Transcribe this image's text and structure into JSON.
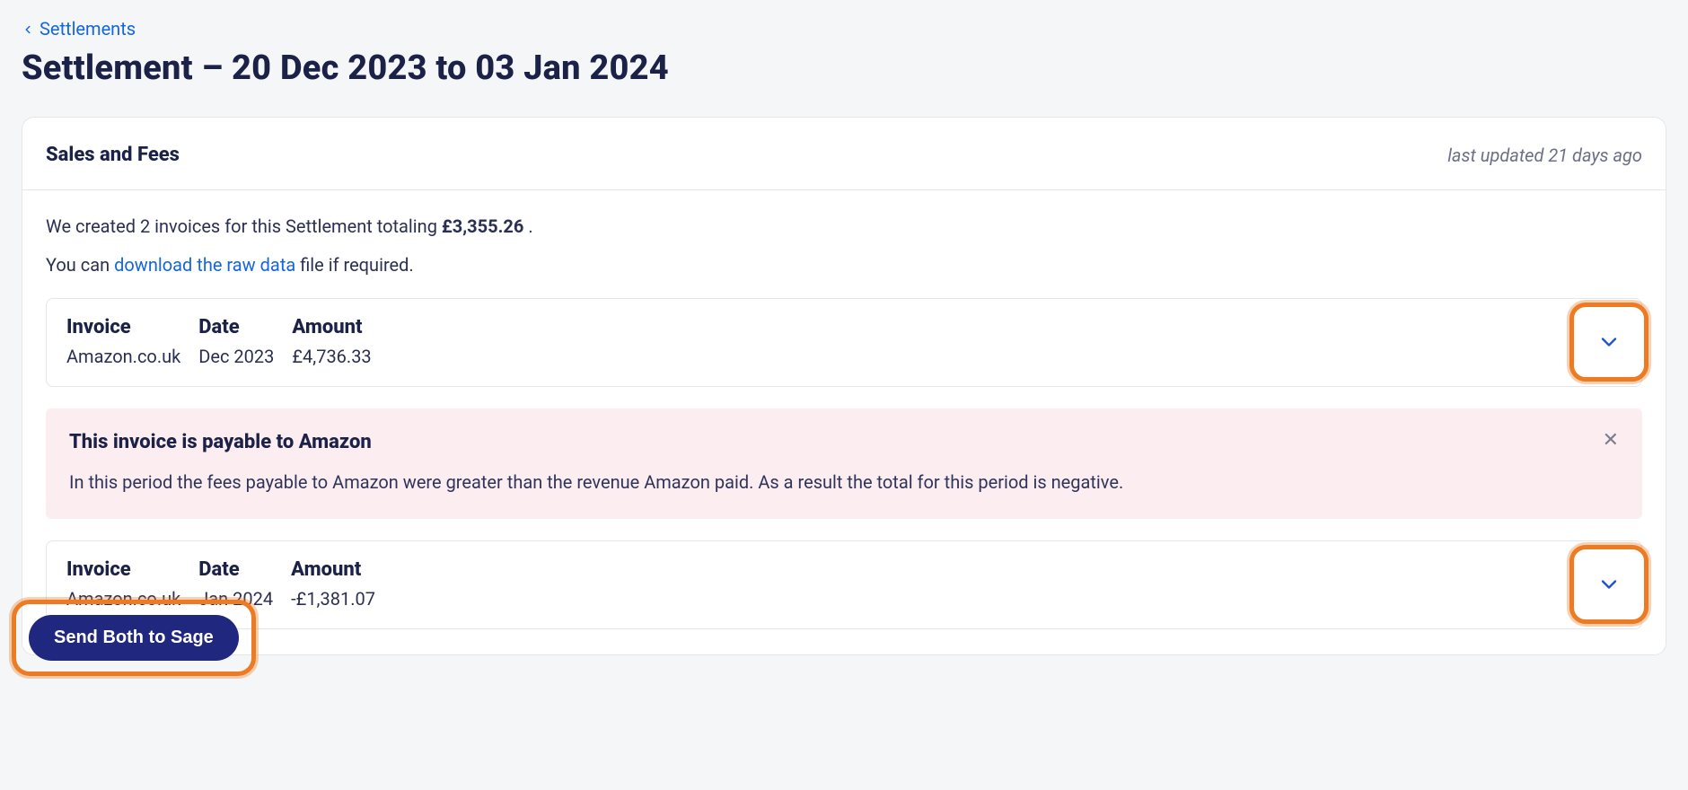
{
  "breadcrumb": {
    "back_label": "Settlements"
  },
  "page_title": "Settlement – 20 Dec 2023 to 03 Jan 2024",
  "colors": {
    "highlight": "#ec7b23",
    "link": "#1366e2",
    "button_bg": "#20277e"
  },
  "card": {
    "title": "Sales and Fees",
    "last_updated": "last updated 21 days ago",
    "intro": {
      "prefix": "We created 2 invoices for this Settlement totaling ",
      "total": "£3,355.26",
      "suffix": " ."
    },
    "download_line": {
      "prefix": "You can ",
      "link_text": "download the raw data",
      "suffix": " file if required."
    },
    "headers": {
      "invoice": "Invoice",
      "date": "Date",
      "amount": "Amount"
    },
    "invoices": [
      {
        "invoice": "Amazon.co.uk",
        "date": "Dec 2023",
        "amount": "£4,736.33"
      },
      {
        "invoice": "Amazon.co.uk",
        "date": "Jan 2024",
        "amount": "-£1,381.07"
      }
    ],
    "alert": {
      "title": "This invoice is payable to Amazon",
      "body": "In this period the fees payable to Amazon were greater than the revenue Amazon paid. As a result the total for this period is negative."
    },
    "send_button": "Send Both to Sage"
  }
}
